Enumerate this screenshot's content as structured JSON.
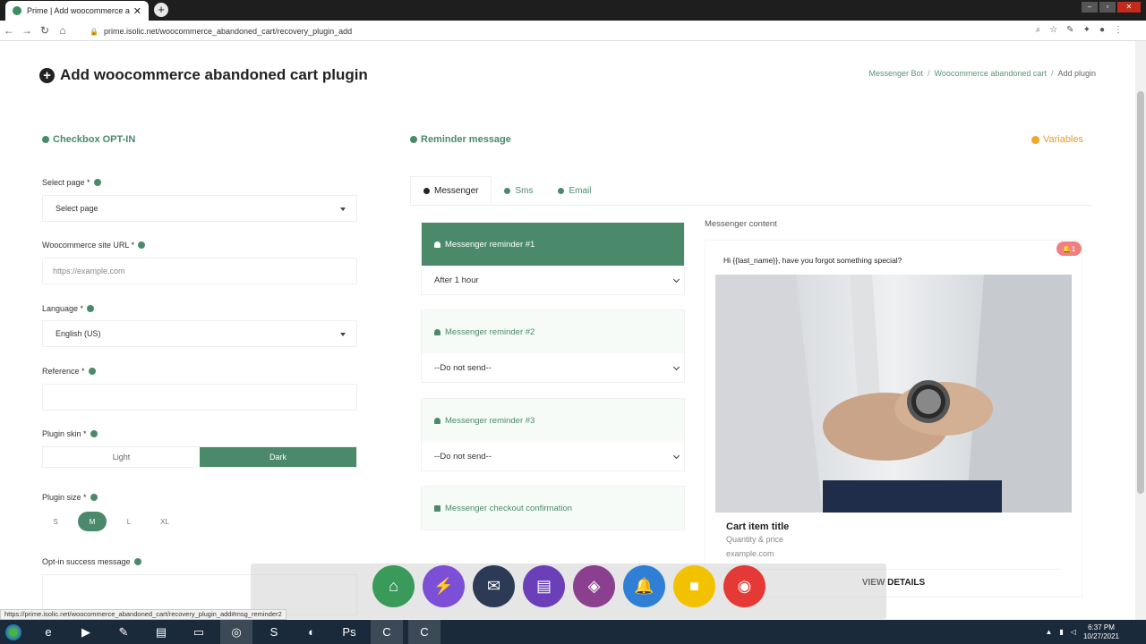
{
  "browser": {
    "tab_title": "Prime | Add woocommerce abandoned ca",
    "tab_close": "✕",
    "new_tab": "+",
    "url": "prime.isolic.net/woocommerce_abandoned_cart/recovery_plugin_add",
    "status_url": "https://prime.isolic.net/woocommerce_abandoned_cart/recovery_plugin_add#msg_reminder2"
  },
  "page": {
    "title": "Add woocommerce abandoned cart plugin",
    "breadcrumb": [
      "Messenger Bot",
      "Woocommerce abandoned cart",
      "Add plugin"
    ],
    "breadcrumb_sep": "/"
  },
  "optin": {
    "title": "Checkbox OPT-IN",
    "select_page_label": "Select page *",
    "select_page_value": "Select page",
    "site_url_label": "Woocommerce site URL *",
    "site_url_placeholder": "https://example.com",
    "language_label": "Language *",
    "language_value": "English (US)",
    "reference_label": "Reference *",
    "skin_label": "Plugin skin *",
    "skin_options": [
      "Light",
      "Dark"
    ],
    "skin_selected": "Dark",
    "size_label": "Plugin size *",
    "size_options": [
      "S",
      "M",
      "L",
      "XL"
    ],
    "size_selected": "M",
    "success_label": "Opt-in success message"
  },
  "reminder": {
    "title": "Reminder message",
    "variables_label": "Variables",
    "tabs": [
      "Messenger",
      "Sms",
      "Email"
    ],
    "active_tab": "Messenger",
    "items": [
      {
        "title": "Messenger reminder #1",
        "value": "After 1 hour"
      },
      {
        "title": "Messenger reminder #2",
        "value": "--Do not send--"
      },
      {
        "title": "Messenger reminder #3",
        "value": "--Do not send--"
      }
    ],
    "checkout": "Messenger checkout confirmation"
  },
  "preview": {
    "label": "Messenger content",
    "badge": "1",
    "message": "Hi {{last_name}}, have you forgot something special?",
    "card_title": "Cart item title",
    "card_sub": "Quantity & price",
    "card_url": "example.com",
    "button": "VIEW DETAILS"
  },
  "taskbar": {
    "time": "6:37 PM",
    "date": "10/27/2021"
  },
  "colors": {
    "primary_green": "#4a8a6a",
    "variables_orange": "#f5a623",
    "badge_red": "#f08080"
  }
}
